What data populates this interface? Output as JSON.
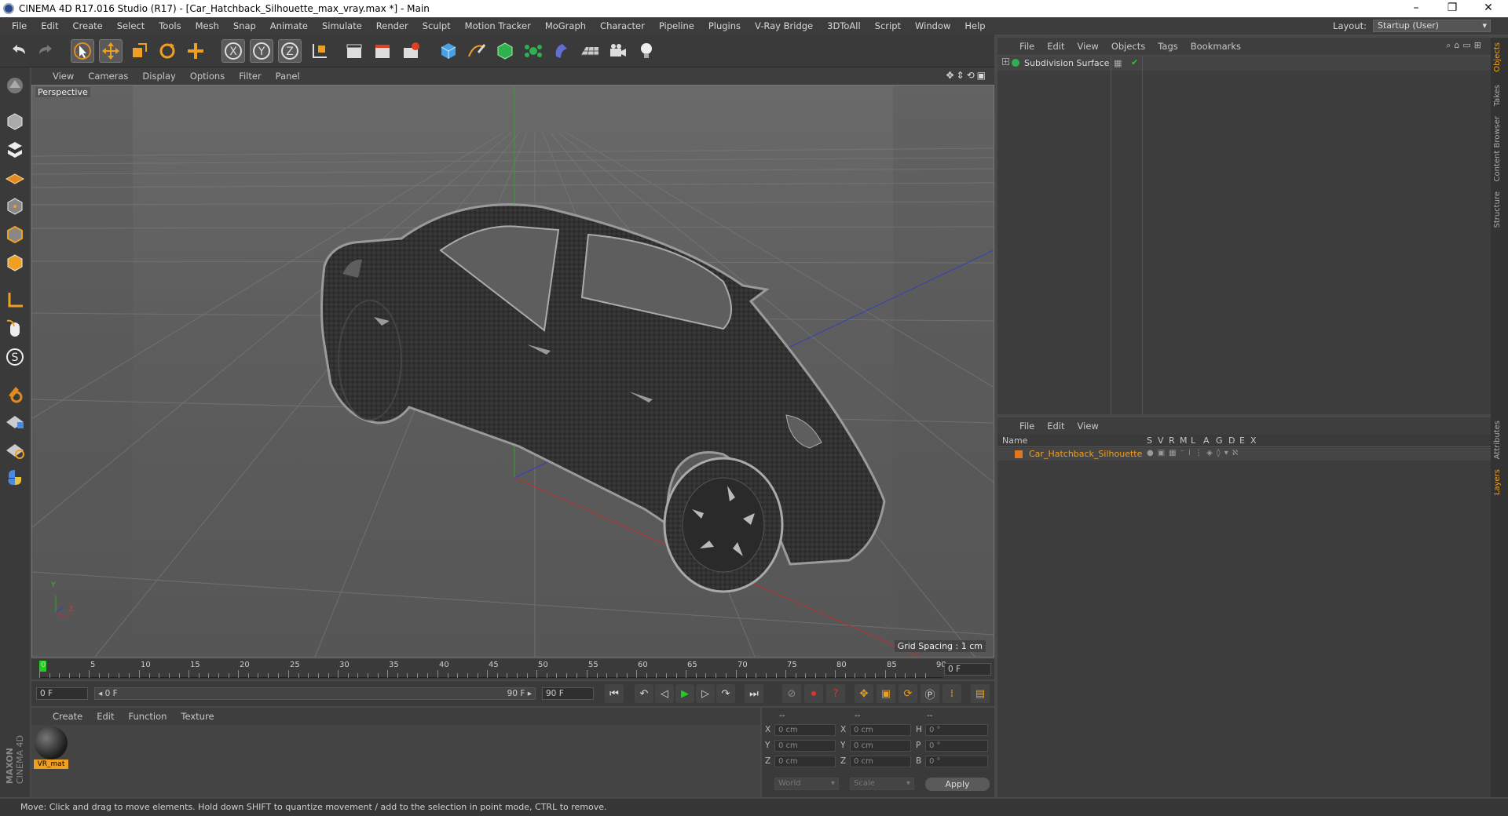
{
  "window": {
    "title": "CINEMA 4D R17.016 Studio (R17) - [Car_Hatchback_Silhouette_max_vray.max *] - Main",
    "controls": [
      "–",
      "❐",
      "✕"
    ]
  },
  "menubar": {
    "items": [
      "File",
      "Edit",
      "Create",
      "Select",
      "Tools",
      "Mesh",
      "Snap",
      "Animate",
      "Simulate",
      "Render",
      "Sculpt",
      "Motion Tracker",
      "MoGraph",
      "Character",
      "Pipeline",
      "Plugins",
      "V-Ray Bridge",
      "3DToAll",
      "Script",
      "Window",
      "Help"
    ],
    "layout_label": "Layout:",
    "layout_value": "Startup (User)"
  },
  "viewport": {
    "menu": [
      "View",
      "Cameras",
      "Display",
      "Options",
      "Filter",
      "Panel"
    ],
    "camera_label": "Perspective",
    "grid_spacing": "Grid Spacing : 1 cm",
    "axis_labels": {
      "y": "Y",
      "z": "Z"
    }
  },
  "timeline": {
    "ticks": [
      "0",
      "5",
      "10",
      "15",
      "20",
      "25",
      "30",
      "35",
      "40",
      "45",
      "50",
      "55",
      "60",
      "65",
      "70",
      "75",
      "80",
      "85",
      "90"
    ],
    "current_frame": "0 F",
    "start_field": "0 F",
    "range_start": "◂ 0 F",
    "range_end": "90 F ▸",
    "end_field": "90 F"
  },
  "material_manager": {
    "menu": [
      "Create",
      "Edit",
      "Function",
      "Texture"
    ],
    "materials": [
      {
        "name": "VR_mat"
      }
    ]
  },
  "coordinates": {
    "headers": [
      "--",
      "--",
      "--"
    ],
    "rows": [
      {
        "a": "X",
        "a_val": "0 cm",
        "b": "X",
        "b_val": "0 cm",
        "c": "H",
        "c_val": "0 °"
      },
      {
        "a": "Y",
        "a_val": "0 cm",
        "b": "Y",
        "b_val": "0 cm",
        "c": "P",
        "c_val": "0 °"
      },
      {
        "a": "Z",
        "a_val": "0 cm",
        "b": "Z",
        "b_val": "0 cm",
        "c": "B",
        "c_val": "0 °"
      }
    ],
    "mode1": "World",
    "mode2": "Scale",
    "apply_label": "Apply"
  },
  "object_manager": {
    "menu": [
      "File",
      "Edit",
      "View",
      "Objects",
      "Tags",
      "Bookmarks"
    ],
    "objects": [
      {
        "name": "Subdivision Surface"
      }
    ]
  },
  "layer_manager": {
    "menu": [
      "File",
      "Edit",
      "View"
    ],
    "columns": [
      "Name",
      "S",
      "V",
      "R",
      "M",
      "L",
      "A",
      "G",
      "D",
      "E",
      "X"
    ],
    "layers": [
      {
        "name": "Car_Hatchback_Silhouette",
        "color": "#e07820"
      }
    ]
  },
  "side_tabs": [
    "Objects",
    "Takes",
    "Content Browser",
    "Structure",
    "Attributes",
    "Layers"
  ],
  "status": "Move: Click and drag to move elements. Hold down SHIFT to quantize movement / add to the selection in point mode, CTRL to remove.",
  "brand": {
    "line1": "MAXON",
    "line2": "CINEMA 4D"
  },
  "colors": {
    "accent_orange": "#f0a020",
    "active_green": "#22cc22",
    "axis_red": "#c03030",
    "axis_green": "#30a030",
    "axis_blue": "#3040c0"
  }
}
